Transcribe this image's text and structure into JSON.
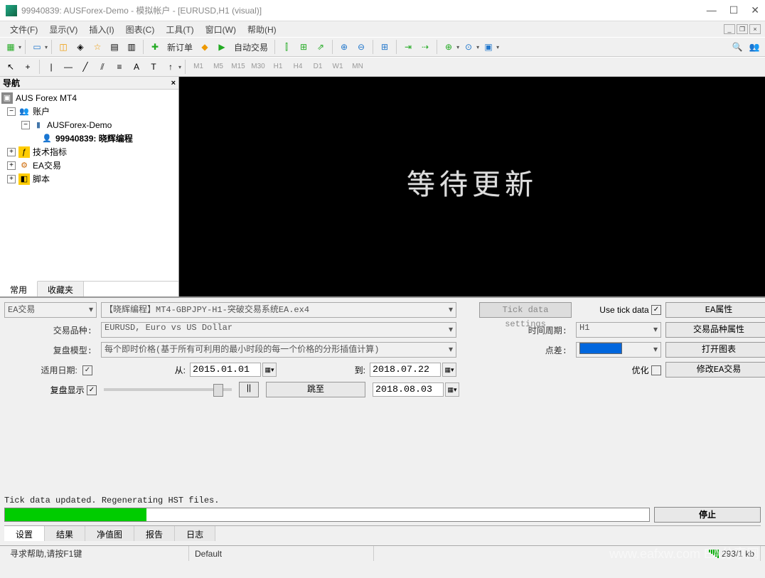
{
  "window": {
    "title": "99940839: AUSForex-Demo - 模拟帐户 - [EURUSD,H1 (visual)]"
  },
  "menu": {
    "file": "文件(F)",
    "view": "显示(V)",
    "insert": "插入(I)",
    "charts": "图表(C)",
    "tools": "工具(T)",
    "window": "窗口(W)",
    "help": "帮助(H)"
  },
  "toolbar": {
    "new_order": "新订单",
    "auto_trading": "自动交易"
  },
  "timeframes": {
    "m1": "M1",
    "m5": "M5",
    "m15": "M15",
    "m30": "M30",
    "h1": "H1",
    "h4": "H4",
    "d1": "D1",
    "w1": "W1",
    "mn": "MN"
  },
  "nav": {
    "title": "导航",
    "root": "AUS Forex MT4",
    "accounts": "账户",
    "server": "AUSForex-Demo",
    "user": "99940839: 晓辉编程",
    "indicators": "技术指标",
    "ea": "EA交易",
    "scripts": "脚本",
    "tab_common": "常用",
    "tab_fav": "收藏夹"
  },
  "chart": {
    "overlay_text": "等待更新"
  },
  "tester": {
    "ea_label": "EA交易",
    "ea_value": "【晓辉编程】MT4-GBPJPY-H1-突破交易系统EA.ex4",
    "tick_settings": "Tick data settings",
    "use_tick_data": "Use tick data",
    "ea_props": "EA属性",
    "symbol_label": "交易品种:",
    "symbol_value": "EURUSD, Euro vs US Dollar",
    "period_label": "时间周期:",
    "period_value": "H1",
    "symbol_props": "交易品种属性",
    "model_label": "复盘模型:",
    "model_value": "每个即时价格(基于所有可利用的最小时段的每一个价格的分形插值计算)",
    "spread_label": "点差:",
    "open_chart": "打开图表",
    "use_date_label": "适用日期:",
    "from_label": "从:",
    "from_date": "2015.01.01",
    "to_label": "到:",
    "to_date": "2018.07.22",
    "optimize_label": "优化",
    "modify_ea": "修改EA交易",
    "replay_label": "复盘显示",
    "jump_to": "跳至",
    "current_date": "2018.08.03",
    "status": "Tick data updated. Regenerating HST files.",
    "stop": "停止",
    "tabs": {
      "settings": "设置",
      "results": "结果",
      "graph": "净值图",
      "report": "报告",
      "journal": "日志"
    }
  },
  "statusbar": {
    "help": "寻求帮助,请按F1键",
    "profile": "Default",
    "connection": "293/1 kb",
    "watermark": "www.eafxw.com EA分享网"
  }
}
